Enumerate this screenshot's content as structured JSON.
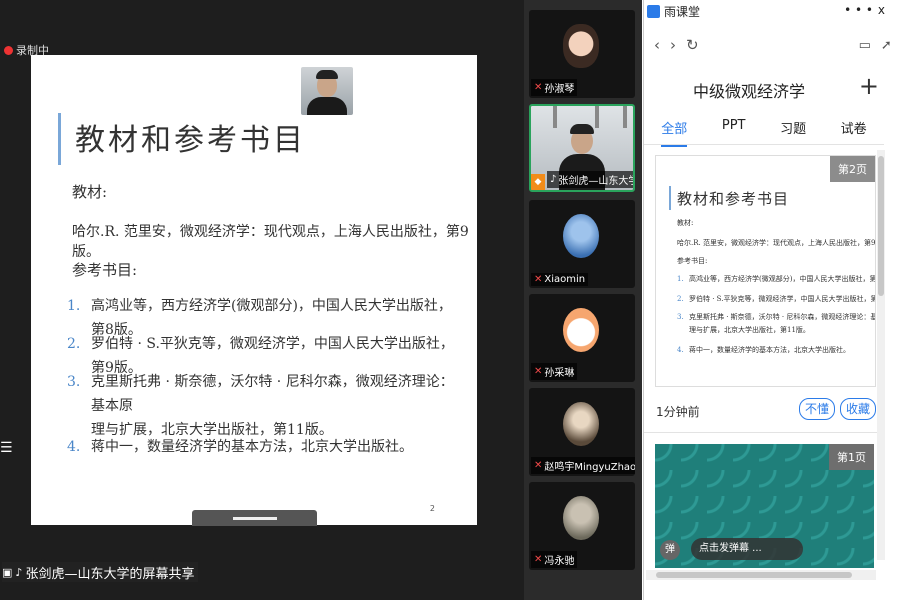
{
  "recording": {
    "label": "录制中"
  },
  "slide": {
    "title": "教材和参考书目",
    "textbook_label": "教材:",
    "textbook": "哈尔.R. 范里安，微观经济学：现代观点，上海人民出版社，第9版。",
    "refs_label": "参考书目:",
    "refs": [
      {
        "num": "1.",
        "lines": [
          "高鸿业等，西方经济学(微观部分)，中国人民大学出版社，第8版。"
        ]
      },
      {
        "num": "2.",
        "lines": [
          "罗伯特 · S.平狄克等，微观经济学，中国人民大学出版社，第9版。"
        ]
      },
      {
        "num": "3.",
        "lines": [
          "克里斯托弗 · 斯奈德，沃尔特 · 尼科尔森，微观经济理论：基本原",
          "理与扩展，北京大学出版社，第11版。"
        ]
      },
      {
        "num": "4.",
        "lines": [
          "蒋中一，数量经济学的基本方法，北京大学出版社。"
        ]
      }
    ],
    "page_num": "2"
  },
  "share_caption": "张剑虎—山东大学的屏幕共享",
  "participants": [
    {
      "name": "孙淑琴",
      "mic": "muted"
    },
    {
      "name": "张剑虎—山东大学",
      "mic": "on"
    },
    {
      "name": "Xiaomin",
      "mic": "muted"
    },
    {
      "name": "孙采琳",
      "mic": "muted"
    },
    {
      "name": "赵鸣宇MingyuZhao",
      "mic": "muted"
    },
    {
      "name": "冯永驰",
      "mic": "muted"
    }
  ],
  "panel": {
    "app_title": "雨课堂",
    "menu_dots": "• • •",
    "close": "x",
    "course_title": "中级微观经济学",
    "add": "+",
    "tabs": [
      "全部",
      "PPT",
      "习题",
      "试卷"
    ],
    "card1": {
      "page_badge": "第2页",
      "mini_title": "教材和参考书目",
      "mini_textbook_label": "教材:",
      "mini_textbook": "哈尔.R. 范里安，微观经济学：现代观点，上海人民出版社，第9版。",
      "mini_refs_label": "参考书目:",
      "mini_refs": [
        {
          "num": "1.",
          "text": "高鸿业等，西方经济学(微观部分)，中国人民大学出版社，第8版。"
        },
        {
          "num": "2.",
          "text": "罗伯特 · S.平狄克等，微观经济学，中国人民大学出版社，第9版。"
        },
        {
          "num": "3.",
          "text": "克里斯托弗 · 斯奈德，沃尔特 · 尼科尔森，微观经济理论：基本原"
        },
        {
          "num": "",
          "text": "理与扩展，北京大学出版社，第11版。"
        },
        {
          "num": "4.",
          "text": "蒋中一，数量经济学的基本方法，北京大学出版社。"
        }
      ],
      "time": "1分钟前",
      "btn_dontget": "不懂",
      "btn_fav": "收藏"
    },
    "card2": {
      "page_badge": "第1页",
      "danmu_icon": "弹",
      "danmu_placeholder": "点击发弹幕 ..."
    }
  }
}
